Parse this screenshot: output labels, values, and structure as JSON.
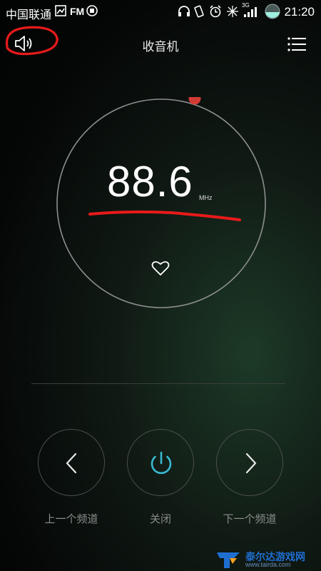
{
  "status_bar": {
    "carrier": "中国联通",
    "fm_label": "FM",
    "network": "3G",
    "time": "21:20"
  },
  "header": {
    "title": "收音机",
    "speaker_icon": "speaker-icon",
    "menu_icon": "menu-list-icon"
  },
  "radio": {
    "frequency": "88.6",
    "unit": "MHz",
    "favorite_icon": "heart-icon"
  },
  "controls": {
    "prev_label": "上一个频道",
    "power_label": "关闭",
    "next_label": "下一个频道"
  },
  "colors": {
    "accent": "#39b9d3",
    "dial_marker": "#d23b34",
    "annotation": "#e81a1a"
  },
  "watermark": {
    "name": "泰尔达游戏网",
    "url": "www.tairda.com"
  }
}
